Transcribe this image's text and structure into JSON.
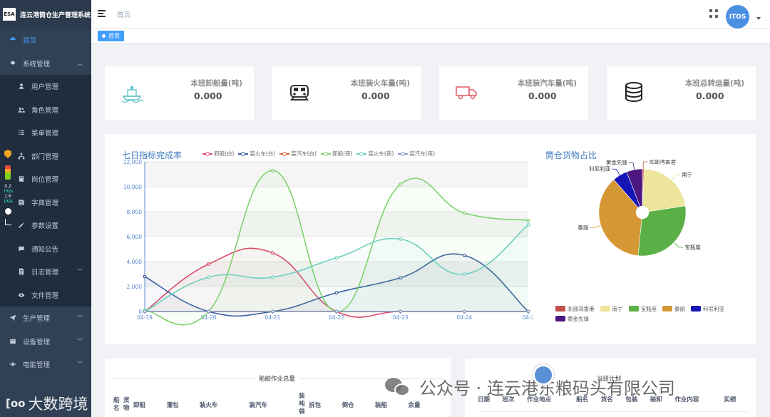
{
  "app": {
    "logo_text": "ESA",
    "title": "连云港筒仓生产管理系统"
  },
  "sidebar": {
    "items": [
      {
        "label": "首页",
        "icon": "dashboard-icon",
        "level": 0,
        "active": true
      },
      {
        "label": "系统管理",
        "icon": "gear-icon",
        "level": 0,
        "expanded": true
      },
      {
        "label": "用户管理",
        "icon": "user-icon",
        "level": 1
      },
      {
        "label": "角色管理",
        "icon": "users-icon",
        "level": 1
      },
      {
        "label": "菜单管理",
        "icon": "menu-list-icon",
        "level": 1
      },
      {
        "label": "部门管理",
        "icon": "org-tree-icon",
        "level": 1
      },
      {
        "label": "岗位管理",
        "icon": "post-icon",
        "level": 1
      },
      {
        "label": "字典管理",
        "icon": "dictionary-icon",
        "level": 1
      },
      {
        "label": "参数设置",
        "icon": "edit-icon",
        "level": 1
      },
      {
        "label": "通知公告",
        "icon": "message-icon",
        "level": 1
      },
      {
        "label": "日志管理",
        "icon": "log-icon",
        "level": 1,
        "has_children": true
      },
      {
        "label": "文件管理",
        "icon": "eye-icon",
        "level": 1
      },
      {
        "label": "生产管理",
        "icon": "send-icon",
        "level": 0,
        "has_children": true
      },
      {
        "label": "设备管理",
        "icon": "equipment-icon",
        "level": 0,
        "has_children": true
      },
      {
        "label": "电能管理",
        "icon": "power-icon",
        "level": 0,
        "has_children": true
      }
    ]
  },
  "overlay_widget": {
    "up_speed": "0.2",
    "up_unit": "K/s",
    "down_speed": "1.6",
    "down_unit": "K/s"
  },
  "navbar": {
    "breadcrumb": "首页",
    "avatar_text": "ITOS"
  },
  "tags": {
    "active": "首页"
  },
  "stats": [
    {
      "label": "本班卸船量(吨)",
      "value": "0.000",
      "icon": "ship-icon"
    },
    {
      "label": "本班装火车量(吨)",
      "value": "0.000",
      "icon": "train-icon"
    },
    {
      "label": "本班装汽车量(吨)",
      "value": "0.000",
      "icon": "truck-icon"
    },
    {
      "label": "本班总转运量(吨)",
      "value": "0.000",
      "icon": "database-icon"
    }
  ],
  "line_chart_title": "七日指标完成率",
  "pie_chart_title": "筒仓货物占比",
  "chart_data": [
    {
      "type": "line",
      "title": "七日指标完成率",
      "x": [
        "04-19",
        "04-20",
        "04-21",
        "04-22",
        "04-23",
        "04-24",
        "04-2"
      ],
      "ylim": [
        0,
        12000
      ],
      "yticks": [
        "0",
        "2,000",
        "4,000",
        "6,000",
        "8,000",
        "10,000",
        "12,000"
      ],
      "grid": true,
      "legend": "top",
      "series": [
        {
          "name": "卸船(白)",
          "color": "#dd4b6b",
          "values": [
            0,
            3800,
            4700,
            0,
            0,
            0,
            0
          ]
        },
        {
          "name": "装火车(白)",
          "color": "#3a5fa0",
          "values": [
            2800,
            0,
            0,
            1500,
            2700,
            4500,
            0
          ]
        },
        {
          "name": "装汽车(白)",
          "color": "#d9673b",
          "values": [
            0,
            0,
            0,
            0,
            0,
            0,
            0
          ]
        },
        {
          "name": "卸船(夜)",
          "color": "#7ed26e",
          "values": [
            100,
            0,
            11300,
            0,
            10200,
            7900,
            7300
          ]
        },
        {
          "name": "装火车(夜)",
          "color": "#6ccfbf",
          "values": [
            0,
            2750,
            2750,
            4300,
            5800,
            3000,
            6950
          ]
        },
        {
          "name": "装汽车(夜)",
          "color": "#7f9cc8",
          "values": [
            0,
            0,
            0,
            0,
            0,
            0,
            0
          ]
        }
      ]
    },
    {
      "type": "pie",
      "title": "筒仓货物占比",
      "legend": "bottom",
      "slices": [
        {
          "name": "北部湾香港",
          "value": 0.6,
          "color": "#c0504d"
        },
        {
          "name": "南宁",
          "value": 22,
          "color": "#ede59b"
        },
        {
          "name": "宝瓶座",
          "value": 29,
          "color": "#5ab046"
        },
        {
          "name": "泰丽",
          "value": 37,
          "color": "#d59634"
        },
        {
          "name": "科尼利亚",
          "value": 5.5,
          "color": "#1515b8"
        },
        {
          "name": "黄金先锋",
          "value": 5.9,
          "color": "#4d1782"
        }
      ]
    }
  ],
  "ship_table": {
    "title": "船舶作业总量",
    "headers": [
      "船名",
      "货物",
      "卸船",
      "灌包",
      "装火车",
      "装汽车",
      "装吨袋",
      "拆包",
      "倒仓",
      "装船",
      "余量"
    ]
  },
  "plan_table": {
    "title": "当班计划",
    "headers": [
      "日期",
      "班次",
      "作业地点",
      "船名",
      "货名",
      "包装",
      "装卸",
      "作业内容",
      "实绩"
    ]
  },
  "watermark": {
    "left_text": "大数跨境",
    "right_text": "公众号 · 连云港东粮码头有限公司"
  }
}
